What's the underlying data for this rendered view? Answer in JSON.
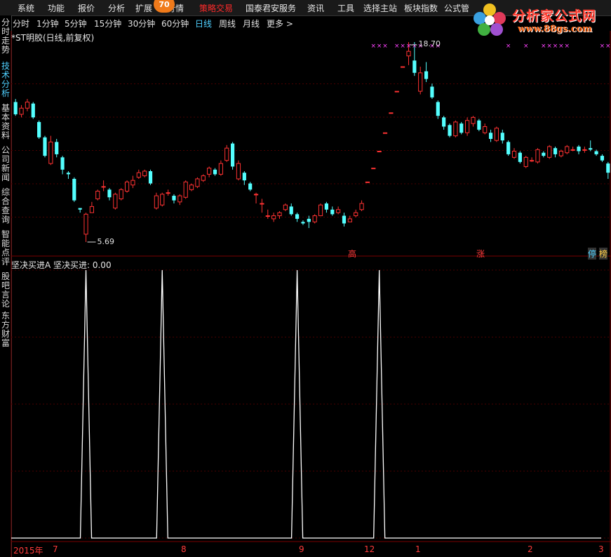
{
  "menu": {
    "items": [
      "系统",
      "功能",
      "报价",
      "分析",
      "扩展",
      "行情",
      "策略交易",
      "国泰君安服务",
      "资讯",
      "工具",
      "选择主站",
      "板块指数",
      "公式管"
    ],
    "badge": "70"
  },
  "logo": {
    "title": "分析家公式网",
    "url": "www.88gs.com"
  },
  "sidebar": {
    "tabs": [
      "分时走势",
      "技术分析",
      "基本资料",
      "公司新闻",
      "综合查询",
      "智能点评",
      "股吧言论",
      "东方财富"
    ],
    "active": 1
  },
  "periods": {
    "items": [
      "分时",
      "1分钟",
      "5分钟",
      "15分钟",
      "30分钟",
      "60分钟",
      "日线",
      "周线",
      "月线",
      "更多 >"
    ],
    "active": "日线"
  },
  "stock_title": "*ST明胶(日线,前复权)",
  "indicator_title": "坚决买进A",
  "indicator_value": "坚决买进: 0.00",
  "markers": {
    "high": "18.70",
    "low": "5.69",
    "tag_gao": "高",
    "tag_zhang": "涨",
    "tag_ting": "停",
    "tag_bang": "榜"
  },
  "date_axis": {
    "labels": [
      "2015年",
      "7",
      "8",
      "9",
      "12",
      "1",
      "2",
      "3"
    ]
  },
  "colors": {
    "up": "#ff3232",
    "down": "#54ffff",
    "menu_hot": "#ff2a2a",
    "active_tab": "#4fd0ff",
    "axis": "#b00000",
    "signal": "#ffffff",
    "cross": "#ff44ff"
  },
  "chart_data": {
    "type": "candlestick",
    "price_range": [
      5.69,
      18.7
    ],
    "candles": [
      [
        14.8,
        14.0,
        15.0,
        13.9
      ],
      [
        14.0,
        14.4,
        14.6,
        13.8
      ],
      [
        14.4,
        14.8,
        15.0,
        14.2
      ],
      [
        14.7,
        13.8,
        14.8,
        13.7
      ],
      [
        13.5,
        12.5,
        13.6,
        12.4
      ],
      [
        12.5,
        11.3,
        12.6,
        11.2
      ],
      [
        10.8,
        12.2,
        12.6,
        10.7
      ],
      [
        12.2,
        11.4,
        12.4,
        11.2
      ],
      [
        11.2,
        10.4,
        11.3,
        10.1
      ],
      [
        10.2,
        10.1,
        10.3,
        9.8
      ],
      [
        9.8,
        8.4,
        9.9,
        8.3
      ],
      [
        7.9,
        7.8,
        7.9,
        7.6
      ],
      [
        6.2,
        7.5,
        7.6,
        5.69
      ],
      [
        7.6,
        8.0,
        8.3,
        7.6
      ],
      [
        8.5,
        9.0,
        9.1,
        8.4
      ],
      [
        9.3,
        9.3,
        9.7,
        9.0
      ],
      [
        9.1,
        8.6,
        9.2,
        8.4
      ],
      [
        7.9,
        8.8,
        8.9,
        7.8
      ],
      [
        8.5,
        9.1,
        9.2,
        8.4
      ],
      [
        9.0,
        9.6,
        9.7,
        8.9
      ],
      [
        9.4,
        9.7,
        10.0,
        9.2
      ],
      [
        9.9,
        10.2,
        10.4,
        9.8
      ],
      [
        10.0,
        10.3,
        10.4,
        9.9
      ],
      [
        10.3,
        9.5,
        10.4,
        9.4
      ],
      [
        7.9,
        8.7,
        8.9,
        7.8
      ],
      [
        8.1,
        8.8,
        8.9,
        8.0
      ],
      [
        8.9,
        8.9,
        9.1,
        8.7
      ],
      [
        8.7,
        8.4,
        8.8,
        8.2
      ],
      [
        8.3,
        8.7,
        8.8,
        8.1
      ],
      [
        8.6,
        9.6,
        9.7,
        8.5
      ],
      [
        9.1,
        9.4,
        9.5,
        9.0
      ],
      [
        9.3,
        9.8,
        9.9,
        9.2
      ],
      [
        9.7,
        10.0,
        10.1,
        9.6
      ],
      [
        10.1,
        10.5,
        10.6,
        9.9
      ],
      [
        10.4,
        10.1,
        10.5,
        10.0
      ],
      [
        10.1,
        10.8,
        11.0,
        10.0
      ],
      [
        11.0,
        11.8,
        12.0,
        10.9
      ],
      [
        12.1,
        10.6,
        12.2,
        10.4
      ],
      [
        9.8,
        10.8,
        11.0,
        9.7
      ],
      [
        10.2,
        9.7,
        10.3,
        9.4
      ],
      [
        9.5,
        9.1,
        9.6,
        9.0
      ],
      [
        8.8,
        8.8,
        8.9,
        8.2
      ],
      [
        8.2,
        8.2,
        8.5,
        7.6
      ],
      [
        7.4,
        7.4,
        7.8,
        7.2
      ],
      [
        7.2,
        7.4,
        7.6,
        7.0
      ],
      [
        7.4,
        7.6,
        7.7,
        7.2
      ],
      [
        7.8,
        8.1,
        8.2,
        7.7
      ],
      [
        8.0,
        7.5,
        8.2,
        7.4
      ],
      [
        7.5,
        7.2,
        7.6,
        7.0
      ],
      [
        7.0,
        6.9,
        7.1,
        6.8
      ],
      [
        7.2,
        7.0,
        7.4,
        6.6
      ],
      [
        7.0,
        7.4,
        7.5,
        6.9
      ],
      [
        7.4,
        8.1,
        8.2,
        7.4
      ],
      [
        8.2,
        7.8,
        8.3,
        7.6
      ],
      [
        7.8,
        7.5,
        8.0,
        7.4
      ],
      [
        7.6,
        7.8,
        8.0,
        7.5
      ],
      [
        7.4,
        6.9,
        7.6,
        6.7
      ],
      [
        7.0,
        7.2,
        7.4,
        7.0
      ],
      [
        7.4,
        7.6,
        7.8,
        7.3
      ],
      [
        7.8,
        8.2,
        8.4,
        7.7
      ],
      [
        9.6,
        9.6,
        9.6,
        9.6
      ],
      [
        10.5,
        10.5,
        10.5,
        10.5
      ],
      [
        11.6,
        11.6,
        11.6,
        11.6
      ],
      [
        12.8,
        12.8,
        12.8,
        12.8
      ],
      [
        14.1,
        14.1,
        14.1,
        14.1
      ],
      [
        15.5,
        15.5,
        15.5,
        15.5
      ],
      [
        17.1,
        17.1,
        17.1,
        17.1
      ],
      [
        17.8,
        18.1,
        18.7,
        17.2
      ],
      [
        17.5,
        16.7,
        18.7,
        16.5
      ],
      [
        15.5,
        16.7,
        17.1,
        15.3
      ],
      [
        16.8,
        16.3,
        17.4,
        16.1
      ],
      [
        15.8,
        15.1,
        16.0,
        15.0
      ],
      [
        14.8,
        13.9,
        14.9,
        13.7
      ],
      [
        13.8,
        13.2,
        13.9,
        13.0
      ],
      [
        13.3,
        12.6,
        13.4,
        12.5
      ],
      [
        12.6,
        13.5,
        13.6,
        12.5
      ],
      [
        13.4,
        12.8,
        13.5,
        12.7
      ],
      [
        12.8,
        13.6,
        13.8,
        12.6
      ],
      [
        13.4,
        13.8,
        13.9,
        13.2
      ],
      [
        13.6,
        13.0,
        13.7,
        12.9
      ],
      [
        12.8,
        13.2,
        13.4,
        12.7
      ],
      [
        12.8,
        12.4,
        13.0,
        12.2
      ],
      [
        12.3,
        13.1,
        13.2,
        12.2
      ],
      [
        12.8,
        12.3,
        13.0,
        12.1
      ],
      [
        12.2,
        11.4,
        12.3,
        11.3
      ],
      [
        11.2,
        11.6,
        11.8,
        11.1
      ],
      [
        11.5,
        10.9,
        11.6,
        10.8
      ],
      [
        10.6,
        11.2,
        11.3,
        10.5
      ],
      [
        11.0,
        11.0,
        11.2,
        10.9
      ],
      [
        10.9,
        11.7,
        11.8,
        10.8
      ],
      [
        11.5,
        11.3,
        11.6,
        11.2
      ],
      [
        11.2,
        11.9,
        12.0,
        11.1
      ],
      [
        11.8,
        11.4,
        11.9,
        11.2
      ],
      [
        11.3,
        11.6,
        11.7,
        11.2
      ],
      [
        11.5,
        11.9,
        12.0,
        11.4
      ],
      [
        11.7,
        11.7,
        11.9,
        11.6
      ],
      [
        11.9,
        11.6,
        12.0,
        11.4
      ],
      [
        11.7,
        11.7,
        11.9,
        11.5
      ],
      [
        11.8,
        11.7,
        12.3,
        11.6
      ],
      [
        11.6,
        11.4,
        11.7,
        11.3
      ],
      [
        11.3,
        11.0,
        11.4,
        10.9
      ],
      [
        10.8,
        10.2,
        10.9,
        9.8
      ]
    ],
    "indicator": {
      "name": "坚决买进",
      "signal_days": [
        12,
        25,
        48,
        62
      ],
      "levels": [
        0,
        0.25,
        0.5,
        0.75,
        1
      ]
    }
  }
}
